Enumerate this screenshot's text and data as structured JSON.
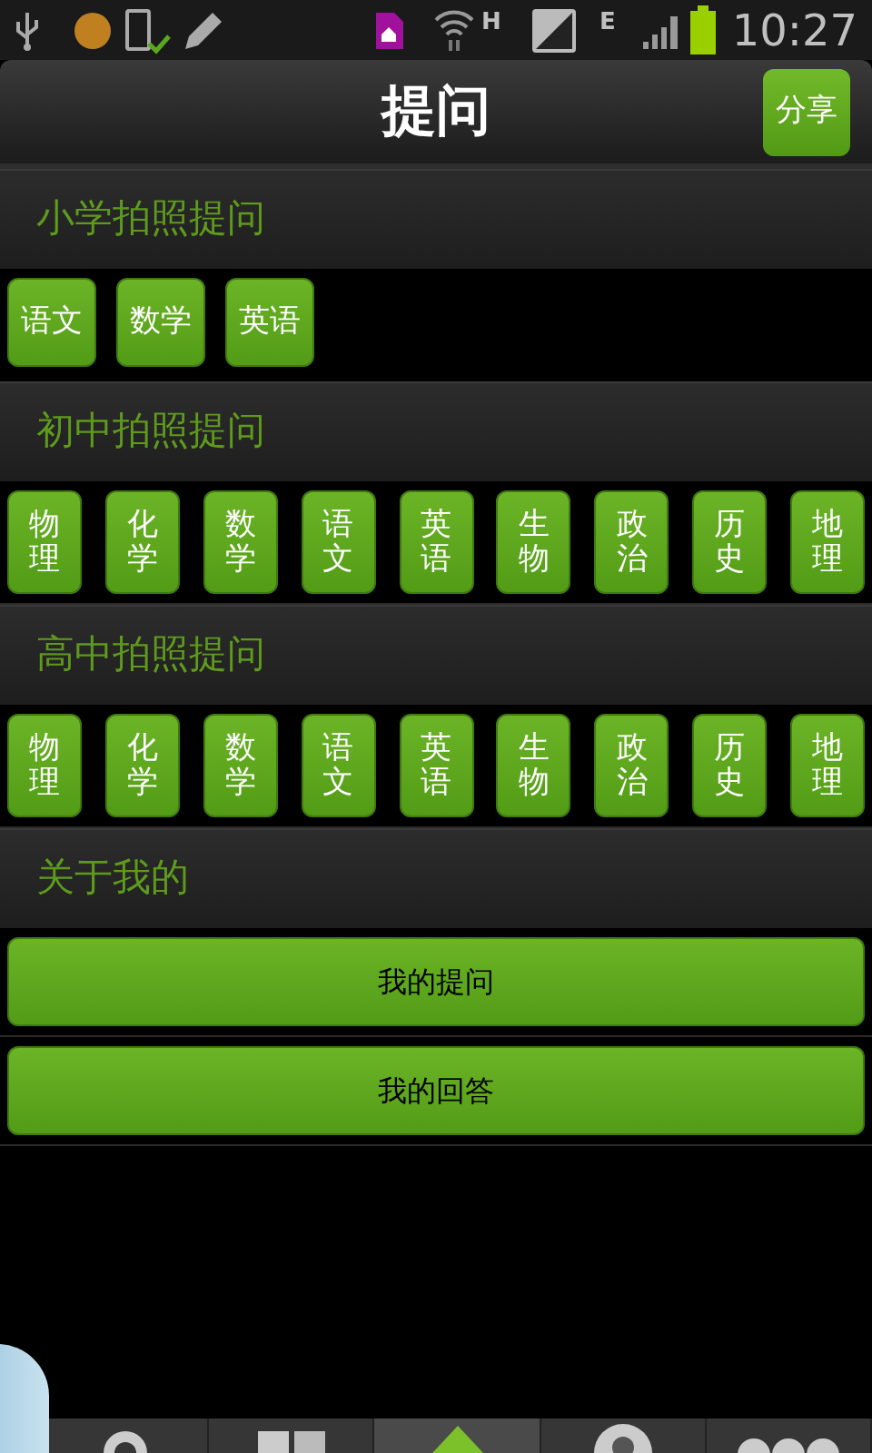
{
  "status_bar": {
    "network_1": "H",
    "network_2": "E",
    "time": "10:27"
  },
  "header": {
    "title": "提问",
    "share_button": "分享"
  },
  "sections": [
    {
      "title": "小学拍照提问",
      "kind": "horizontal",
      "buttons": [
        "语文",
        "数学",
        "英语"
      ]
    },
    {
      "title": "初中拍照提问",
      "kind": "vertical",
      "buttons": [
        "物理",
        "化学",
        "数学",
        "语文",
        "英语",
        "生物",
        "政治",
        "历史",
        "地理"
      ]
    },
    {
      "title": "高中拍照提问",
      "kind": "vertical",
      "buttons": [
        "物理",
        "化学",
        "数学",
        "语文",
        "英语",
        "生物",
        "政治",
        "历史",
        "地理"
      ]
    },
    {
      "title": "关于我的",
      "kind": "wide",
      "buttons": [
        "我的提问",
        "我的回答"
      ]
    }
  ],
  "bottom_nav": [
    {
      "kind": "search",
      "selected": false
    },
    {
      "kind": "grid",
      "selected": false
    },
    {
      "kind": "home",
      "selected": true
    },
    {
      "kind": "person",
      "selected": false
    },
    {
      "kind": "more",
      "selected": false
    }
  ]
}
